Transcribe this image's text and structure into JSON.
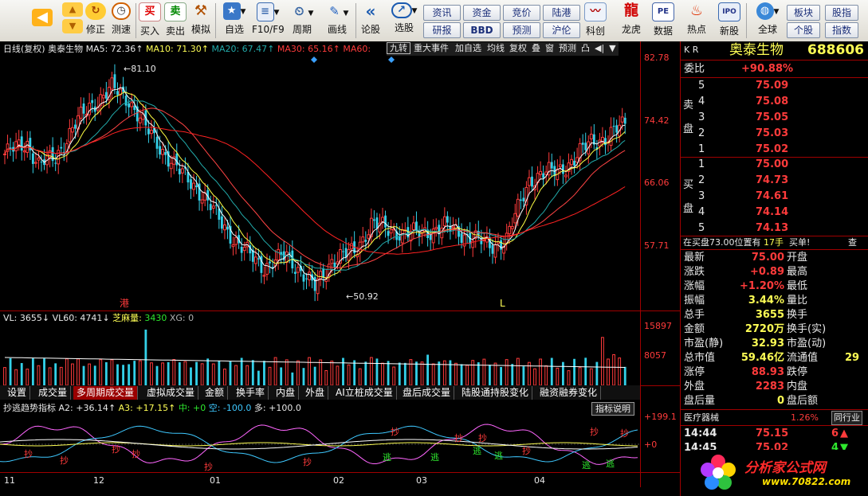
{
  "toolbar": {
    "buttons": [
      {
        "label": "后退",
        "icon": "back-arrow-icon"
      },
      {
        "label": "修正",
        "icon": "refresh-icon"
      },
      {
        "label": "测速",
        "icon": "clock-icon"
      },
      {
        "label": "买入",
        "icon": "buy-icon",
        "glyph": "买"
      },
      {
        "label": "卖出",
        "icon": "sell-icon",
        "glyph": "卖"
      },
      {
        "label": "模拟",
        "icon": "hammer-icon"
      },
      {
        "label": "自选",
        "icon": "star-folder-icon"
      },
      {
        "label": "F10/F9",
        "icon": "document-icon"
      },
      {
        "label": "周期",
        "icon": "period-icon"
      },
      {
        "label": "画线",
        "icon": "pencil-icon"
      },
      {
        "label": "论股",
        "icon": "quote-icon"
      },
      {
        "label": "选股",
        "icon": "select-stock-icon"
      },
      {
        "label": "科创",
        "icon": "chart-icon"
      },
      {
        "label": "龙虎",
        "icon": "dragon-icon"
      },
      {
        "label": "数据",
        "icon": "pe-icon"
      },
      {
        "label": "热点",
        "icon": "flame-icon"
      },
      {
        "label": "新股",
        "icon": "ipo-icon"
      },
      {
        "label": "全球",
        "icon": "globe-icon"
      }
    ],
    "quick": [
      [
        "资讯",
        "资金",
        "竞价",
        "陆港"
      ],
      [
        "研报",
        "BBD",
        "预测",
        "沪伦"
      ]
    ],
    "right": [
      [
        "板块",
        "股指"
      ],
      [
        "个股",
        "指数"
      ]
    ]
  },
  "chart_header": {
    "period": "日线(复权)",
    "stock": "奥泰生物",
    "ma5": "MA5: 72.36",
    "ma10": "MA10: 71.30",
    "ma20": "MA20: 67.47",
    "ma30": "MA30: 65.16",
    "ma60": "MA60:",
    "arrows": "↑",
    "tools": [
      "九转",
      "重大事件",
      "加自选",
      "均线",
      "复权",
      "叠",
      "窗",
      "预测",
      "凸",
      "◀|",
      "▼"
    ]
  },
  "colors": {
    "up": "#ff3b3b",
    "down": "#33d0e8",
    "ma5": "#ffffff",
    "ma10": "#ffff44",
    "ma20": "#22aaaa",
    "ma30": "#ff4444",
    "ma60": "#ff2222",
    "grid": "#a00000"
  },
  "price_axis": [
    "82.78",
    "74.42",
    "66.06",
    "57.71"
  ],
  "annotations": {
    "high": "81.10",
    "low": "50.92",
    "hk_marker": "港",
    "l_marker": "L"
  },
  "vol_header": {
    "vl": "VL: 3655",
    "vl60": "VL60: 4741",
    "sesame_label": "芝麻量:",
    "sesame": "3430",
    "xg": "XG: 0"
  },
  "vol_axis": [
    "15897",
    "8057"
  ],
  "tabs": [
    "设置",
    "成交量",
    "多周期成交量",
    "虚拟成交量",
    "金额",
    "换手率",
    "内盘",
    "外盘",
    "AI立桩成交量",
    "盘后成交量",
    "陆股通持股变化",
    "融资融券变化"
  ],
  "indicator": {
    "name": "抄逃趋势指标",
    "a2": "A2: +36.14",
    "a3": "A3: +17.15",
    "zhong": "中: +0",
    "kong": "空: -100.0",
    "duo": "多: +100.0",
    "explain": "指标说明",
    "axis_top": "+199.1",
    "axis_zero": "+0"
  },
  "indicator_labels": {
    "buy": "抄",
    "sell": "逃"
  },
  "x_axis": [
    "11",
    "12",
    "01",
    "02",
    "03",
    "04"
  ],
  "quote": {
    "kr": "K R",
    "name": "奥泰生物",
    "code": "688606",
    "weibi_label": "委比",
    "weibi": "+90.88%",
    "sell_label": "卖盘",
    "buy_label": "买盘",
    "sell": [
      [
        "5",
        "75.09"
      ],
      [
        "4",
        "75.08"
      ],
      [
        "3",
        "75.05"
      ],
      [
        "2",
        "75.03"
      ],
      [
        "1",
        "75.02"
      ]
    ],
    "buy": [
      [
        "1",
        "75.00"
      ],
      [
        "2",
        "74.73"
      ],
      [
        "3",
        "74.61"
      ],
      [
        "4",
        "74.14"
      ],
      [
        "5",
        "74.13"
      ]
    ],
    "inbuy": "在买盘73.00位置有",
    "inbuy_qty": "17手",
    "inbuy_tag": "买单!",
    "inbuy_more": "查",
    "stats_left": [
      [
        "最新",
        "75.00"
      ],
      [
        "涨跌",
        "+0.89"
      ],
      [
        "涨幅",
        "+1.20%"
      ],
      [
        "振幅",
        "3.44%"
      ],
      [
        "总手",
        "3655"
      ],
      [
        "金额",
        "2720万"
      ],
      [
        "市盈(静)",
        "32.93"
      ],
      [
        "总市值",
        "59.46亿"
      ],
      [
        "涨停",
        "88.93"
      ],
      [
        "外盘",
        "2283"
      ],
      [
        "盘后量",
        "0"
      ]
    ],
    "stats_right": [
      "开盘",
      "最高",
      "最低",
      "量比",
      "换手",
      "换手(实)",
      "市盈(动)",
      "流通值",
      "跌停",
      "内盘",
      "盘后额"
    ],
    "stats_right_partial": {
      "liutong": "29"
    },
    "industry": "医疗器械",
    "industry_chg": "1.26%",
    "industry_tab": "同行业",
    "ticks": [
      [
        "14:44",
        "75.15",
        "6"
      ],
      [
        "14:45",
        "75.02",
        "4"
      ]
    ]
  },
  "watermark": {
    "title": "分析家公式网",
    "url": "www.70822.com"
  }
}
